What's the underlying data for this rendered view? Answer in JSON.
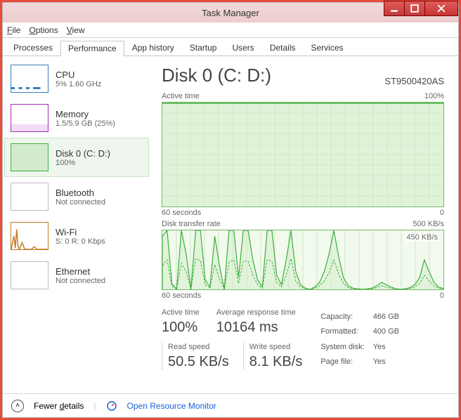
{
  "window": {
    "title": "Task Manager"
  },
  "menu": {
    "file": "File",
    "options": "Options",
    "view": "View"
  },
  "tabs": {
    "processes": "Processes",
    "performance": "Performance",
    "app_history": "App history",
    "startup": "Startup",
    "users": "Users",
    "details": "Details",
    "services": "Services"
  },
  "sidebar": [
    {
      "title": "CPU",
      "sub": "5% 1.60 GHz"
    },
    {
      "title": "Memory",
      "sub": "1.5/5.9 GB (25%)"
    },
    {
      "title": "Disk 0 (C: D:)",
      "sub": "100%"
    },
    {
      "title": "Bluetooth",
      "sub": "Not connected"
    },
    {
      "title": "Wi-Fi",
      "sub": "S: 0 R: 0 Kbps"
    },
    {
      "title": "Ethernet",
      "sub": "Not connected"
    }
  ],
  "main": {
    "title": "Disk 0 (C: D:)",
    "model": "ST9500420AS",
    "chart1": {
      "label": "Active time",
      "max": "100%",
      "xleft": "60 seconds",
      "xright": "0"
    },
    "chart2": {
      "label": "Disk transfer rate",
      "max": "500 KB/s",
      "inner_label": "450 KB/s",
      "xleft": "60 seconds",
      "xright": "0"
    },
    "stats": {
      "active_time_lbl": "Active time",
      "active_time_val": "100%",
      "avg_resp_lbl": "Average response time",
      "avg_resp_val": "10164 ms",
      "read_lbl": "Read speed",
      "read_val": "50.5 KB/s",
      "write_lbl": "Write speed",
      "write_val": "8.1 KB/s"
    },
    "kv": {
      "capacity_lbl": "Capacity:",
      "capacity_val": "466 GB",
      "formatted_lbl": "Formatted:",
      "formatted_val": "400 GB",
      "sysdisk_lbl": "System disk:",
      "sysdisk_val": "Yes",
      "pagefile_lbl": "Page file:",
      "pagefile_val": "Yes"
    }
  },
  "footer": {
    "fewer": "Fewer details",
    "monitor": "Open Resource Monitor"
  },
  "chart_data": [
    {
      "type": "area",
      "title": "Active time",
      "ylabel": "%",
      "ylim": [
        0,
        100
      ],
      "xlabel": "seconds",
      "xlim": [
        60,
        0
      ],
      "series": [
        {
          "name": "Active time %",
          "values": [
            100,
            100,
            100,
            100,
            100,
            100,
            100,
            100,
            100,
            100,
            100,
            100,
            100,
            100,
            100,
            100,
            100,
            100,
            100,
            100,
            100,
            100,
            100,
            100,
            100,
            100,
            100,
            100,
            100,
            100,
            100,
            100,
            100,
            100,
            100,
            100,
            100,
            100,
            100,
            100,
            100,
            100,
            100,
            100,
            100,
            100,
            100,
            100,
            100,
            100,
            100,
            100,
            100,
            100,
            100,
            100,
            100,
            100,
            100,
            100
          ]
        }
      ]
    },
    {
      "type": "line",
      "title": "Disk transfer rate",
      "ylabel": "KB/s",
      "ylim": [
        0,
        500
      ],
      "xlabel": "seconds",
      "xlim": [
        60,
        0
      ],
      "annotations": [
        "450 KB/s"
      ],
      "series": [
        {
          "name": "Total KB/s",
          "values": [
            450,
            500,
            50,
            0,
            500,
            300,
            0,
            500,
            500,
            80,
            20,
            450,
            200,
            0,
            500,
            500,
            100,
            500,
            500,
            250,
            80,
            20,
            500,
            500,
            120,
            40,
            250,
            500,
            150,
            40,
            10,
            0,
            20,
            60,
            150,
            300,
            500,
            280,
            100,
            30,
            10,
            5,
            0,
            5,
            10,
            30,
            60,
            40,
            20,
            5,
            0,
            5,
            15,
            40,
            100,
            250,
            150,
            60,
            20,
            5
          ]
        },
        {
          "name": "Write KB/s (dashed)",
          "values": [
            200,
            250,
            30,
            0,
            220,
            150,
            0,
            260,
            240,
            40,
            10,
            210,
            90,
            0,
            230,
            250,
            50,
            240,
            240,
            120,
            40,
            10,
            250,
            240,
            60,
            20,
            120,
            260,
            70,
            20,
            5,
            0,
            10,
            30,
            70,
            140,
            250,
            130,
            50,
            15,
            5,
            2,
            0,
            2,
            5,
            15,
            30,
            20,
            10,
            2,
            0,
            2,
            8,
            20,
            50,
            120,
            70,
            30,
            10,
            2
          ]
        }
      ]
    }
  ]
}
